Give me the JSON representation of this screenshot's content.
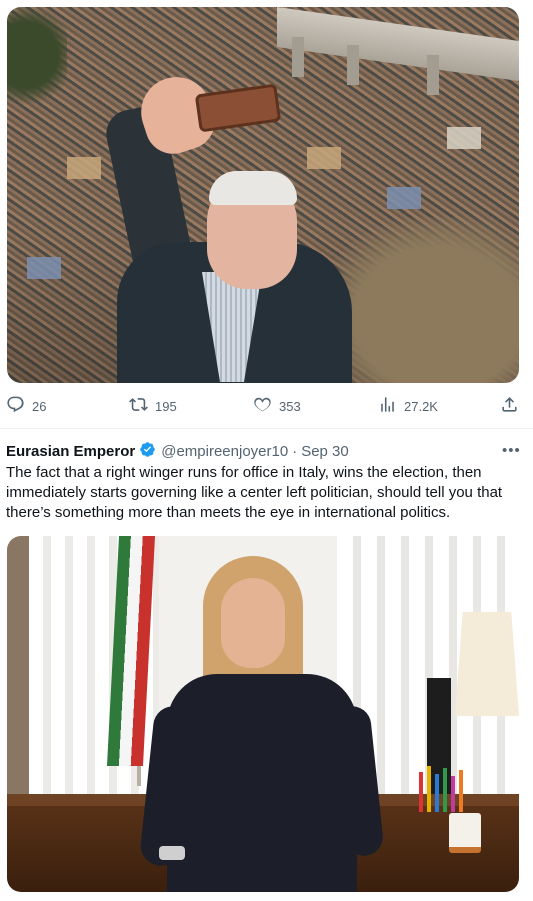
{
  "tweet1": {
    "media": {
      "alt_icon": "selfie-crowd-photo"
    },
    "actions": {
      "reply_count": "26",
      "retweet_count": "195",
      "like_count": "353",
      "views_count": "27.2K"
    }
  },
  "tweet2": {
    "author": "Eurasian Emperor",
    "handle": "@empireenjoyer10",
    "separator": "·",
    "time": "Sep 30",
    "text": "The fact that a right winger runs for office in Italy, wins the election, then immediately starts governing like a center left politician, should tell you that there’s something more than meets the eye in international politics.",
    "media": {
      "alt_icon": "office-portrait-photo"
    }
  },
  "icons": {
    "reply": "reply-icon",
    "retweet": "retweet-icon",
    "like": "heart-icon",
    "views": "views-icon",
    "share": "share-icon",
    "verified": "verified-badge-icon",
    "more": "more-icon"
  },
  "colors": {
    "text_primary": "#0f1419",
    "text_secondary": "#536471",
    "verified_blue": "#1d9bf0",
    "divider": "#eff3f4"
  }
}
